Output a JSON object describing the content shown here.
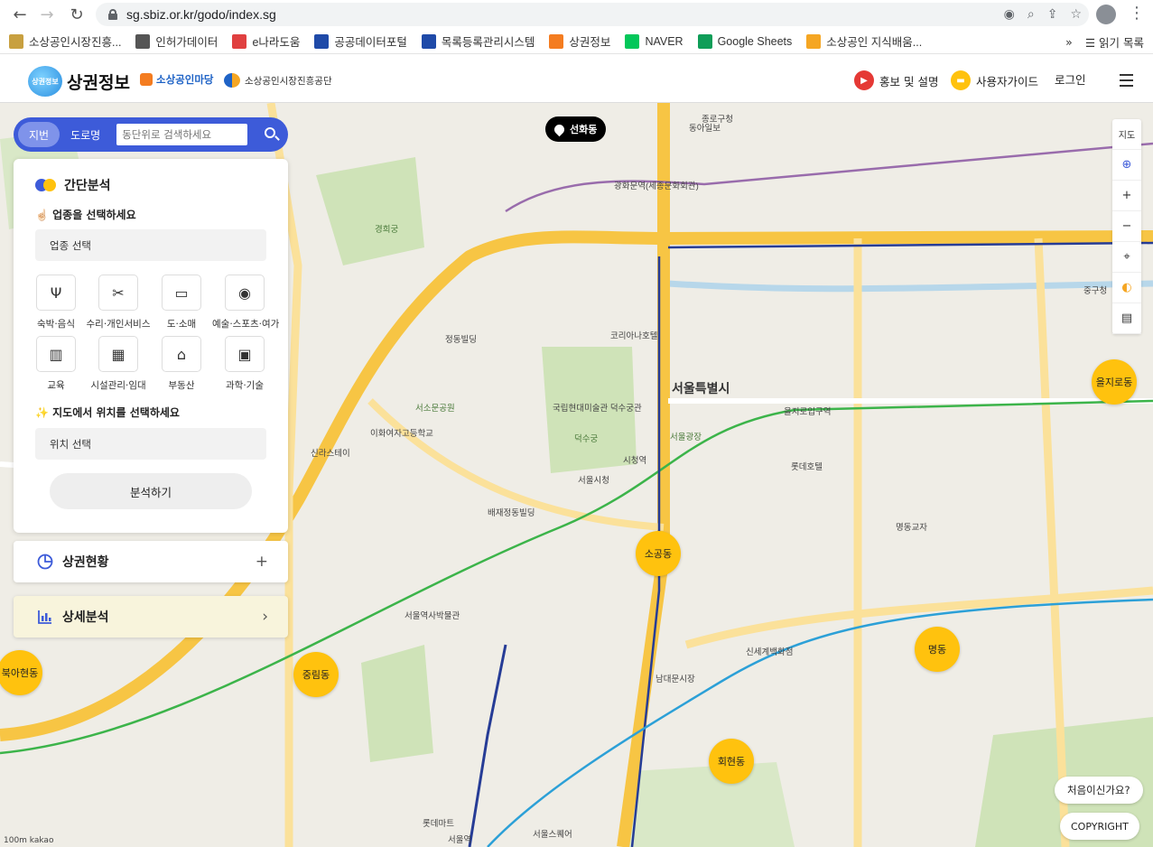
{
  "browser": {
    "url": "sg.sbiz.or.kr/godo/index.sg",
    "bookmarks": [
      "소상공인시장진흥...",
      "인허가데이터",
      "e나라도움",
      "공공데이터포털",
      "목록등록관리시스템",
      "상권정보",
      "NAVER",
      "Google Sheets",
      "소상공인 지식배움..."
    ],
    "bookmark_colors": [
      "#c8a040",
      "#555555",
      "#e04040",
      "#1f4aa8",
      "#1f4aa8",
      "#f47c20",
      "#03c75a",
      "#0f9d58",
      "#f5a623"
    ],
    "reading_list": "읽기 목록"
  },
  "header": {
    "logo_text": "상권정보",
    "site_title": "상권정보",
    "partner1": "소상공인마당",
    "partner2": "소상공인시장진흥공단",
    "promo": "홍보 및 설명",
    "guide": "사용자가이드",
    "login": "로그인"
  },
  "search": {
    "tab_lot": "지번",
    "tab_road": "도로명",
    "placeholder": "동단위로 검색하세요"
  },
  "panel": {
    "title": "간단분석",
    "step1": "☝🏻 업종을 선택하세요",
    "industry_select": "업종 선택",
    "categories": [
      {
        "label": "숙박·음식",
        "icon": "fork-knife-icon",
        "glyph": "Ψ"
      },
      {
        "label": "수리·개인서비스",
        "icon": "tools-icon",
        "glyph": "✂"
      },
      {
        "label": "도·소매",
        "icon": "register-icon",
        "glyph": "▭"
      },
      {
        "label": "예술·스포츠·여가",
        "icon": "ball-icon",
        "glyph": "◉"
      },
      {
        "label": "교육",
        "icon": "book-icon",
        "glyph": "▥"
      },
      {
        "label": "시설관리·임대",
        "icon": "building-icon",
        "glyph": "▦"
      },
      {
        "label": "부동산",
        "icon": "house-icon",
        "glyph": "⌂"
      },
      {
        "label": "과학·기술",
        "icon": "monitor-icon",
        "glyph": "▣"
      }
    ],
    "step2": "✨ 지도에서 위치를 선택하세요",
    "location_select": "위치 선택",
    "analyze": "분석하기"
  },
  "accordions": {
    "status": "상권현황",
    "detail": "상세분석"
  },
  "map": {
    "pin_label": "선화동",
    "city_label": "서울특별시",
    "dong_markers": [
      "소공동",
      "중림동",
      "명동",
      "회현동",
      "을지로동",
      "북아현동"
    ],
    "labels": [
      "종로구청",
      "경희궁",
      "서울역",
      "덕수궁",
      "서울시청",
      "국립현대미술관 덕수궁관",
      "을지로입구역",
      "시청역",
      "광화문역(세종문화회관)",
      "남대문시장",
      "서울스퀘어",
      "롯데마트",
      "정동빌딩",
      "동아일보",
      "코리아나호텔",
      "서울광장",
      "신세계백화점",
      "명동교자",
      "롯데호텔",
      "중구청",
      "서소문공원",
      "배재정동빌딩",
      "이화여자고등학교",
      "신라스테이",
      "서울역사박물관"
    ],
    "scale": "100m kakao"
  },
  "controls": {
    "map_type": "지도",
    "locate": "⊕",
    "zoom_in": "+",
    "zoom_out": "−"
  },
  "help": "처음이신가요?",
  "copyright": "COPYRIGHT"
}
